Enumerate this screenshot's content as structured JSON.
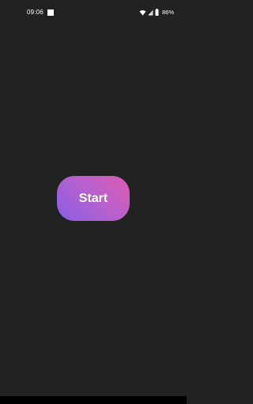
{
  "status_bar": {
    "time": "09:06",
    "battery": "86%",
    "icons": [
      "notification-square-icon",
      "wifi-icon",
      "signal-icon",
      "battery-icon"
    ]
  },
  "main": {
    "start_label": "Start"
  },
  "colors": {
    "background": "#222222",
    "button_gradient_start": "#8a5ee6",
    "button_gradient_end": "#dd5cb4",
    "text": "#ffffff"
  }
}
